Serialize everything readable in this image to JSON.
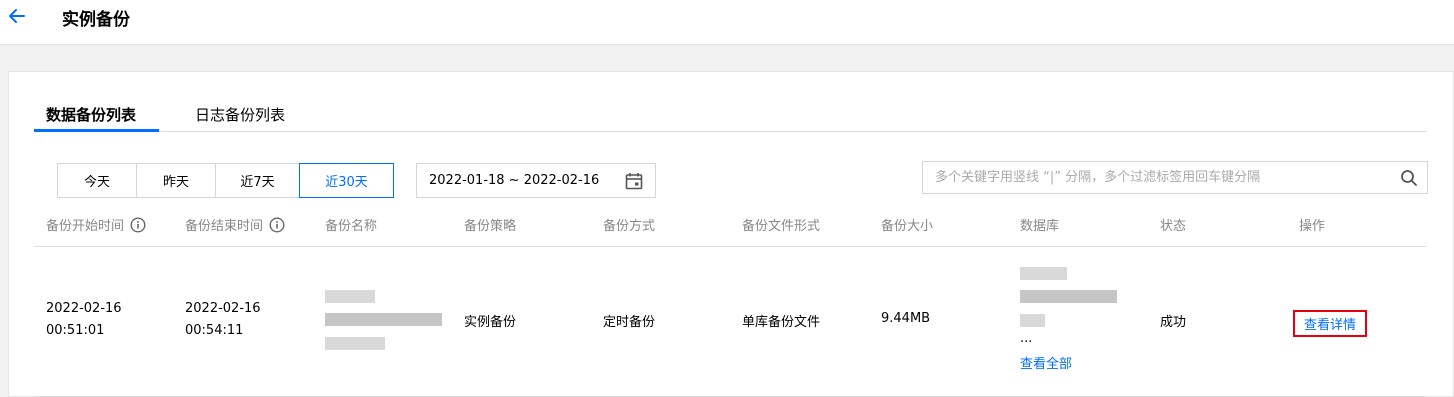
{
  "header": {
    "title": "实例备份"
  },
  "tabs": [
    {
      "label": "数据备份列表"
    },
    {
      "label": "日志备份列表"
    }
  ],
  "filters": {
    "ranges": [
      {
        "label": "今天"
      },
      {
        "label": "昨天"
      },
      {
        "label": "近7天"
      },
      {
        "label": "近30天"
      }
    ],
    "selected_range": "近30天",
    "date_range": "2022-01-18 ~ 2022-02-16",
    "search_placeholder": "多个关键字用竖线 “|” 分隔，多个过滤标签用回车键分隔"
  },
  "table": {
    "columns": [
      {
        "label": "备份开始时间",
        "info": true
      },
      {
        "label": "备份结束时间",
        "info": true
      },
      {
        "label": "备份名称"
      },
      {
        "label": "备份策略"
      },
      {
        "label": "备份方式"
      },
      {
        "label": "备份文件形式"
      },
      {
        "label": "备份大小"
      },
      {
        "label": "数据库"
      },
      {
        "label": "状态"
      },
      {
        "label": "操作"
      }
    ],
    "rows": [
      {
        "start_date": "2022-02-16",
        "start_time": "00:51:01",
        "end_date": "2022-02-16",
        "end_time": "00:54:11",
        "strategy": "实例备份",
        "method": "定时备份",
        "file_form": "单库备份文件",
        "size": "9.44MB",
        "db_more": "...",
        "db_view_all": "查看全部",
        "status": "成功",
        "action": "查看详情"
      }
    ]
  },
  "colors": {
    "accent": "#006eff",
    "highlight_border": "#e4000f",
    "header_text": "#888888"
  }
}
